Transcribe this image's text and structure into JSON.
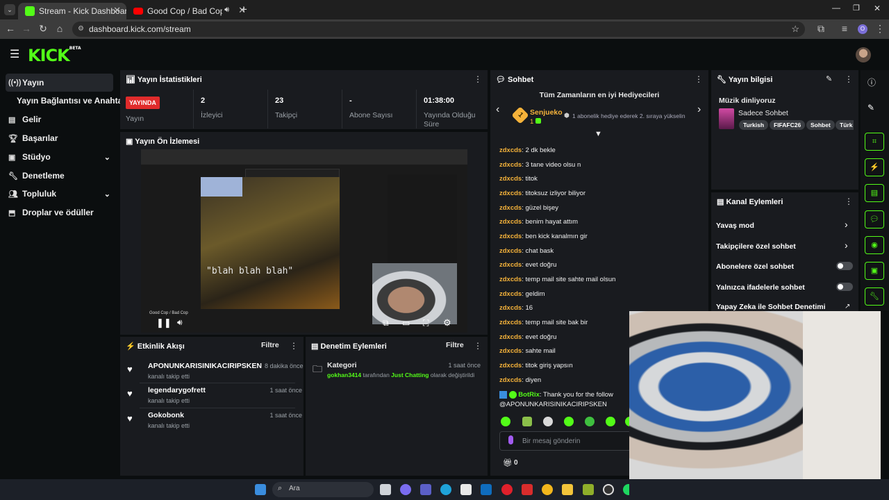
{
  "browser": {
    "tabs": [
      {
        "title": "Stream - Kick Dashboard",
        "active": true
      },
      {
        "title": "Good Cop / Bad Cop - YouT",
        "active": false
      }
    ],
    "new_tab": "+",
    "url": "dashboard.kick.com/stream"
  },
  "kick": {
    "logo": "KICK",
    "logo_badge": "BETA"
  },
  "sidebar": {
    "items": [
      {
        "label": "Yayın",
        "icon": "broadcast-icon"
      },
      {
        "label": "Yayın Bağlantısı ve Anahtarı",
        "icon": ""
      },
      {
        "label": "Gelir",
        "icon": "revenue-icon"
      },
      {
        "label": "Başarılar",
        "icon": "trophy-icon"
      },
      {
        "label": "Stüdyo",
        "icon": "studio-icon"
      },
      {
        "label": "Denetleme",
        "icon": "wrench-icon"
      },
      {
        "label": "Topluluk",
        "icon": "community-icon"
      },
      {
        "label": "Droplar ve ödüller",
        "icon": "drops-icon"
      }
    ]
  },
  "stats": {
    "title": "Yayın İstatistikleri",
    "live_badge": "YAYINDA",
    "live_label": "Yayın",
    "cells": [
      {
        "value": "2",
        "label": "İzleyici"
      },
      {
        "value": "23",
        "label": "Takipçi"
      },
      {
        "value": "-",
        "label": "Abone Sayısı"
      },
      {
        "value": "01:38:00",
        "label": "Yayında Olduğu Süre"
      }
    ]
  },
  "preview": {
    "title": "Yayın Ön İzlemesi",
    "overlay_text": "\"blah blah blah\"",
    "video_title": "Good Cop / Bad Cop"
  },
  "activity": {
    "title": "Etkinlik Akışı",
    "filter": "Filtre",
    "events": [
      {
        "name": "APONUNKARISINIKACIRIPSKEN",
        "sub": "kanalı takip etti",
        "time": "8 dakika önce"
      },
      {
        "name": "legendarygofrett",
        "sub": "kanalı takip etti",
        "time": "1 saat önce"
      },
      {
        "name": "Gokobonk",
        "sub": "kanalı takip etti",
        "time": "1 saat önce"
      }
    ]
  },
  "moderation": {
    "title": "Denetim Eylemleri",
    "filter": "Filtre",
    "event": {
      "title": "Kategori",
      "time": "1 saat önce",
      "user": "gokhan3414",
      "mid": "tarafından",
      "category": "Just Chatting",
      "suffix": "olarak değiştirildi"
    }
  },
  "chat": {
    "title": "Sohbet",
    "gifters_title": "Tüm Zamanların en iyi Hediyecileri",
    "top_gifter": {
      "rank": "1",
      "name": "Senjueko",
      "count": "1"
    },
    "gift_hint": "1 abonelik hediye ederek 2. sıraya yükselin",
    "messages": [
      {
        "user": "zdxcds",
        "text": "2 dk bekle"
      },
      {
        "user": "zdxcds",
        "text": "3 tane video olsu n"
      },
      {
        "user": "zdxcds",
        "text": "titok"
      },
      {
        "user": "zdxcds",
        "text": "titoksuz izliyor biliyor"
      },
      {
        "user": "zdxcds",
        "text": "güzel bişey"
      },
      {
        "user": "zdxcds",
        "text": "benim hayat attım"
      },
      {
        "user": "zdxcds",
        "text": "ben kick kanalmın gir"
      },
      {
        "user": "zdxcds",
        "text": "chat bask"
      },
      {
        "user": "zdxcds",
        "text": "evet doğru"
      },
      {
        "user": "zdxcds",
        "text": "temp mail site sahte mail olsun"
      },
      {
        "user": "zdxcds",
        "text": "geldim"
      },
      {
        "user": "zdxcds",
        "text": "16"
      },
      {
        "user": "zdxcds",
        "text": "temp mail site bak bir"
      },
      {
        "user": "zdxcds",
        "text": "evet doğru"
      },
      {
        "user": "zdxcds",
        "text": "sahte mail"
      },
      {
        "user": "zdxcds",
        "text": "titok giriş yapsın"
      },
      {
        "user": "zdxcds",
        "text": "diyen"
      }
    ],
    "bot": {
      "user": "BotRix",
      "text": "Thank you for the follow",
      "line2": "@APONUNKARISINIKACIRIPSKEN"
    },
    "input_placeholder": "Bir mesaj gönderin",
    "gift_count": "0"
  },
  "stream_info": {
    "title": "Yayın bilgisi",
    "stream_title": "Müzik dinliyoruz",
    "category": "Sadece Sohbet",
    "tags": [
      "Turkish",
      "FIFAFC26",
      "Sohbet",
      "Türk"
    ]
  },
  "channel_actions": {
    "title": "Kanal Eylemleri",
    "rows": [
      {
        "label": "Yavaş mod",
        "control": "arrow"
      },
      {
        "label": "Takipçilere özel sohbet",
        "control": "arrow"
      },
      {
        "label": "Abonelere özel sohbet",
        "control": "toggle"
      },
      {
        "label": "Yalnızca ifadelerle sohbet",
        "control": "toggle"
      },
      {
        "label": "Yapay Zeka ile Sohbet Denetimi",
        "control": "external"
      }
    ]
  },
  "taskbar": {
    "search": "Ara"
  },
  "colors": {
    "brand": "#53fc18",
    "live": "#e02b2b",
    "username": "#f5b23a",
    "panel": "#191b1f",
    "bg": "#0b0e0f"
  }
}
